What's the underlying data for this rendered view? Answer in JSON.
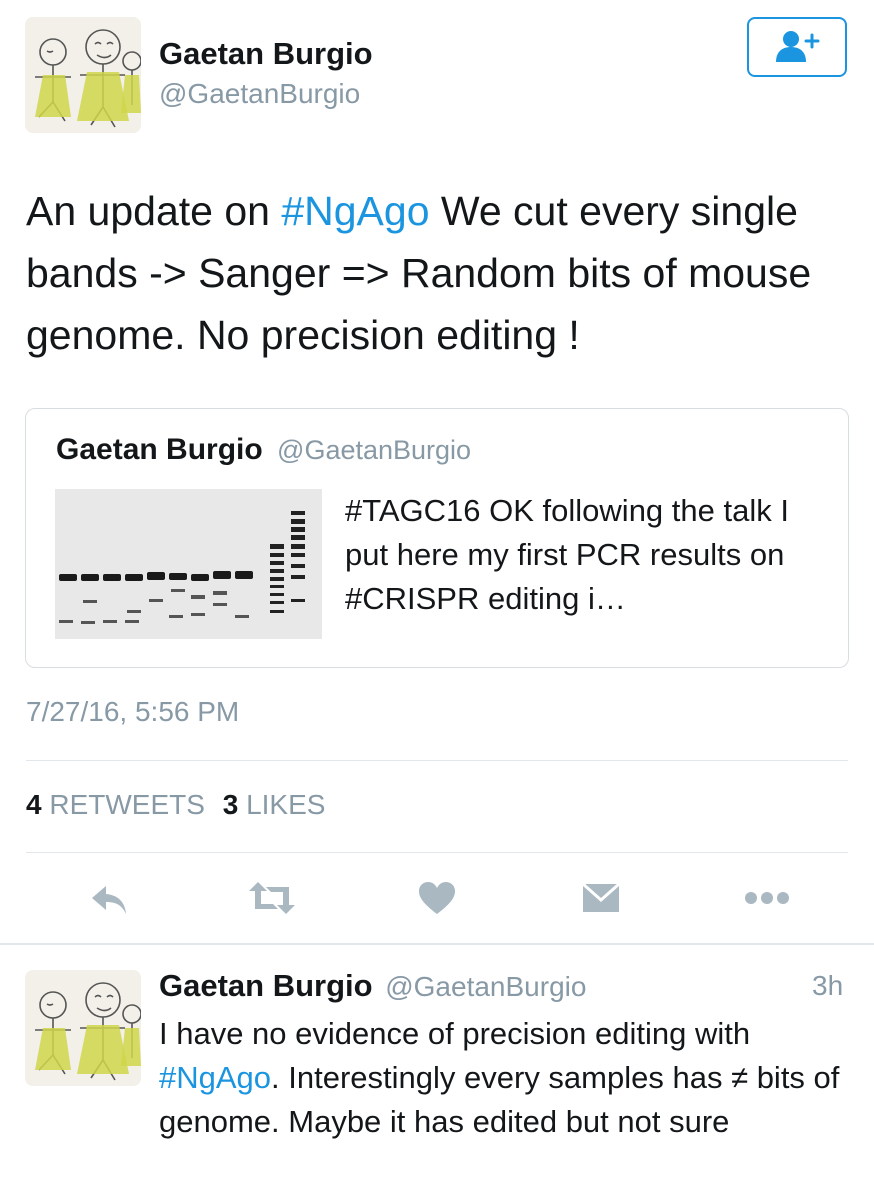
{
  "main_tweet": {
    "author_name": "Gaetan Burgio",
    "author_handle": "@GaetanBurgio",
    "text_part1": "An update on ",
    "hashtag": "#NgAgo",
    "text_part2": " We cut every single bands -> Sanger => Random bits of mouse genome. No precision editing !",
    "timestamp": "7/27/16, 5:56 PM",
    "retweets_count": "4",
    "retweets_label": "RETWEETS",
    "likes_count": "3",
    "likes_label": "LIKES"
  },
  "quoted_tweet": {
    "author_name": "Gaetan Burgio",
    "author_handle": "@GaetanBurgio",
    "text": "#TAGC16 OK following the talk I put here my first PCR results on #CRISPR editing i…"
  },
  "actions": [
    {
      "name": "reply",
      "icon": "reply-icon"
    },
    {
      "name": "retweet",
      "icon": "retweet-icon"
    },
    {
      "name": "like",
      "icon": "heart-icon"
    },
    {
      "name": "direct-message",
      "icon": "envelope-icon"
    },
    {
      "name": "more",
      "icon": "more-icon"
    }
  ],
  "reply_tweet": {
    "author_name": "Gaetan Burgio",
    "author_handle": "@GaetanBurgio",
    "time_ago": "3h",
    "text_part1": "I have no evidence of precision editing with ",
    "hashtag": "#NgAgo",
    "text_part2": ". Interestingly every samples has ≠ bits of genome. Maybe it has edited but not sure"
  },
  "colors": {
    "accent": "#1b95e0",
    "muted": "#8899a6",
    "icon": "#aab8c2",
    "text": "#14171a"
  }
}
